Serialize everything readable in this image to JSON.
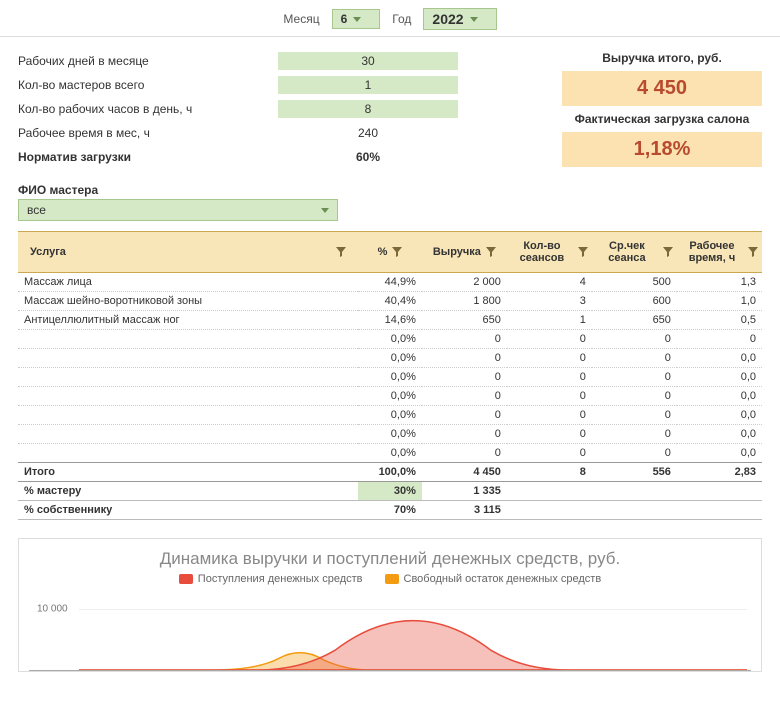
{
  "controls": {
    "month_label": "Месяц",
    "month_value": "6",
    "year_label": "Год",
    "year_value": "2022"
  },
  "metrics": {
    "days_label": "Рабочих дней в месяце",
    "days_value": "30",
    "masters_label": "Кол-во мастеров всего",
    "masters_value": "1",
    "hours_day_label": "Кол-во рабочих часов в день, ч",
    "hours_day_value": "8",
    "work_time_label": "Рабочее время в мес, ч",
    "work_time_value": "240",
    "norm_label": "Норматив загрузки",
    "norm_value": "60%"
  },
  "kpi": {
    "revenue_title": "Выручка итого, руб.",
    "revenue_value": "4 450",
    "load_title": "Фактическая загрузка салона",
    "load_value": "1,18%"
  },
  "master": {
    "label": "ФИО мастера",
    "value": "все"
  },
  "table": {
    "headers": {
      "service": "Услуга",
      "pct": "%",
      "revenue": "Выручка",
      "sessions": "Кол-во сеансов",
      "avg": "Ср.чек сеанса",
      "time": "Рабочее время, ч"
    },
    "rows": [
      {
        "service": "Массаж лица",
        "pct": "44,9%",
        "rev": "2 000",
        "ses": "4",
        "avg": "500",
        "time": "1,3"
      },
      {
        "service": "Массаж шейно-воротниковой зоны",
        "pct": "40,4%",
        "rev": "1 800",
        "ses": "3",
        "avg": "600",
        "time": "1,0"
      },
      {
        "service": "Антицеллюлитный массаж ног",
        "pct": "14,6%",
        "rev": "650",
        "ses": "1",
        "avg": "650",
        "time": "0,5"
      },
      {
        "service": "",
        "pct": "0,0%",
        "rev": "0",
        "ses": "0",
        "avg": "0",
        "time": "0"
      },
      {
        "service": "",
        "pct": "0,0%",
        "rev": "0",
        "ses": "0",
        "avg": "0",
        "time": "0,0"
      },
      {
        "service": "",
        "pct": "0,0%",
        "rev": "0",
        "ses": "0",
        "avg": "0",
        "time": "0,0"
      },
      {
        "service": "",
        "pct": "0,0%",
        "rev": "0",
        "ses": "0",
        "avg": "0",
        "time": "0,0"
      },
      {
        "service": "",
        "pct": "0,0%",
        "rev": "0",
        "ses": "0",
        "avg": "0",
        "time": "0,0"
      },
      {
        "service": "",
        "pct": "0,0%",
        "rev": "0",
        "ses": "0",
        "avg": "0",
        "time": "0,0"
      },
      {
        "service": "",
        "pct": "0,0%",
        "rev": "0",
        "ses": "0",
        "avg": "0",
        "time": "0,0"
      }
    ],
    "total": {
      "label": "Итого",
      "pct": "100,0%",
      "rev": "4 450",
      "ses": "8",
      "avg": "556",
      "time": "2,83"
    },
    "master_share": {
      "label": "% мастеру",
      "pct": "30%",
      "rev": "1 335"
    },
    "owner_share": {
      "label": "% собственнику",
      "pct": "70%",
      "rev": "3 115"
    }
  },
  "chart": {
    "title": "Динамика выручки и поступлений денежных средств, руб.",
    "legend": {
      "series1": "Поступления денежных средств",
      "series2": "Свободный остаток денежных средств"
    },
    "ytick": "10 000"
  },
  "chart_data": {
    "type": "area",
    "title": "Динамика выручки и поступлений денежных средств, руб.",
    "xlabel": "",
    "ylabel": "руб.",
    "ylim": [
      0,
      10000
    ],
    "series": [
      {
        "name": "Поступления денежных средств",
        "color": "#e74c3c",
        "values": [
          0,
          0,
          0,
          800,
          2500,
          6000,
          2500,
          800,
          0,
          0,
          0,
          0
        ]
      },
      {
        "name": "Свободный остаток денежных средств",
        "color": "#f39c12",
        "values": [
          0,
          0,
          600,
          1800,
          700,
          0,
          0,
          0,
          0,
          0,
          0,
          0
        ]
      }
    ]
  }
}
